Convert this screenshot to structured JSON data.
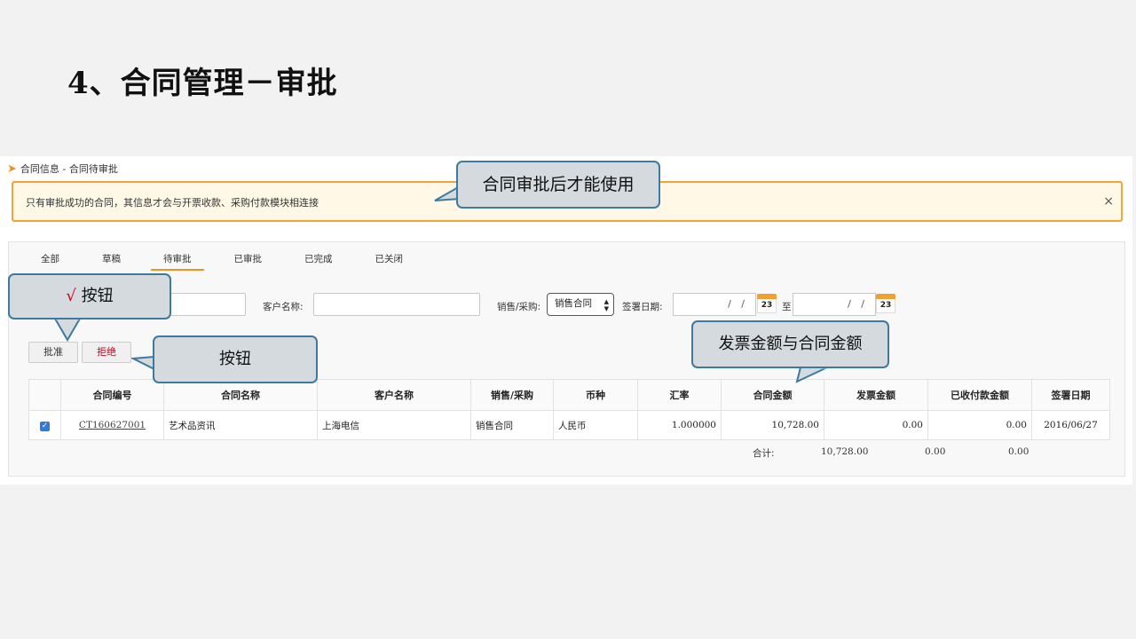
{
  "slide": {
    "title": "4、合同管理－审批"
  },
  "breadcrumb": {
    "text": "合同信息 - 合同待审批"
  },
  "notice": {
    "text": "只有审批成功的合同，其信息才会与开票收款、采购付款模块相连接",
    "close": "×"
  },
  "tabs": [
    "全部",
    "草稿",
    "待审批",
    "已审批",
    "已完成",
    "已关闭"
  ],
  "active_tab": "待审批",
  "filters": {
    "customer_label": "客户名称:",
    "type_label": "销售/采购:",
    "type_value": "销售合同",
    "date_label": "签署日期:",
    "date_placeholder": "/ /",
    "date_sep": "至",
    "calendar_day": "23"
  },
  "buttons": {
    "approve": "批准",
    "reject": "拒绝"
  },
  "table": {
    "headers": [
      "合同编号",
      "合同名称",
      "客户名称",
      "销售/采购",
      "币种",
      "汇率",
      "合同金额",
      "发票金额",
      "已收付款金额",
      "签署日期"
    ],
    "rows": [
      {
        "checked": true,
        "id": "CT160627001",
        "name": "艺术品资讯",
        "customer": "上海电信",
        "type": "销售合同",
        "currency": "人民币",
        "rate": "1.000000",
        "amount": "10,728.00",
        "invoice": "0.00",
        "paid": "0.00",
        "date": "2016/06/27"
      }
    ],
    "totals": {
      "label": "合计:",
      "amount": "10,728.00",
      "invoice": "0.00",
      "paid": "0.00"
    }
  },
  "callouts": {
    "approval": "合同审批后才能使用",
    "check": "按钮",
    "check_mark": "√",
    "buttons": "按钮",
    "amounts": "发票金额与合同金额"
  },
  "colors": {
    "accent": "#f0921e",
    "notice_border": "#f2a33a",
    "callout_border": "#3d7a9e",
    "reject_text": "#d0021b"
  }
}
